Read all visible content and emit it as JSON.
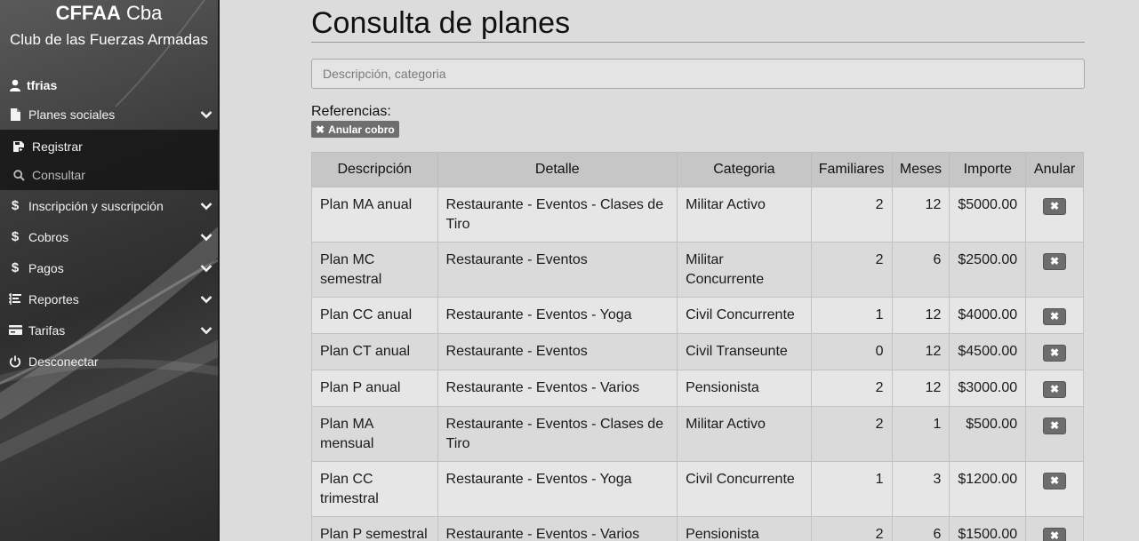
{
  "sidebar": {
    "brand_bold": "CFFAA",
    "brand_rest": " Cba",
    "brand_sub": "Club de las Fuerzas Armadas",
    "user": "tfrias",
    "items": [
      {
        "label": "Planes sociales",
        "icon": "file-icon"
      },
      {
        "label": "Inscripción y suscripción",
        "icon": "dollar-icon"
      },
      {
        "label": "Cobros",
        "icon": "dollar-icon"
      },
      {
        "label": "Pagos",
        "icon": "dollar-icon"
      },
      {
        "label": "Reportes",
        "icon": "list-icon"
      },
      {
        "label": "Tarifas",
        "icon": "card-icon"
      },
      {
        "label": "Desconectar",
        "icon": "power-icon"
      }
    ],
    "submenu": [
      {
        "label": "Registrar",
        "icon": "register-icon"
      },
      {
        "label": "Consultar",
        "icon": "search-icon"
      }
    ]
  },
  "main": {
    "title": "Consulta de planes",
    "search_placeholder": "Descripción, categoria",
    "refs_label": "Referencias:",
    "badge_label": "Anular cobro",
    "columns": [
      "Descripción",
      "Detalle",
      "Categoria",
      "Familiares",
      "Meses",
      "Importe",
      "Anular"
    ],
    "rows": [
      {
        "desc": "Plan MA anual",
        "detalle": "Restaurante - Eventos - Clases de Tiro",
        "categoria": "Militar Activo",
        "familiares": "2",
        "meses": "12",
        "importe": "$5000.00"
      },
      {
        "desc": "Plan MC semestral",
        "detalle": "Restaurante - Eventos",
        "categoria": "Militar Concurrente",
        "familiares": "2",
        "meses": "6",
        "importe": "$2500.00"
      },
      {
        "desc": "Plan CC anual",
        "detalle": "Restaurante - Eventos - Yoga",
        "categoria": "Civil Concurrente",
        "familiares": "1",
        "meses": "12",
        "importe": "$4000.00"
      },
      {
        "desc": "Plan CT anual",
        "detalle": "Restaurante - Eventos",
        "categoria": "Civil Transeunte",
        "familiares": "0",
        "meses": "12",
        "importe": "$4500.00"
      },
      {
        "desc": "Plan P anual",
        "detalle": "Restaurante - Eventos - Varios",
        "categoria": "Pensionista",
        "familiares": "2",
        "meses": "12",
        "importe": "$3000.00"
      },
      {
        "desc": "Plan MA mensual",
        "detalle": "Restaurante - Eventos - Clases de Tiro",
        "categoria": "Militar Activo",
        "familiares": "2",
        "meses": "1",
        "importe": "$500.00"
      },
      {
        "desc": "Plan CC trimestral",
        "detalle": "Restaurante - Eventos - Yoga",
        "categoria": "Civil Concurrente",
        "familiares": "1",
        "meses": "3",
        "importe": "$1200.00"
      },
      {
        "desc": "Plan P semestral",
        "detalle": "Restaurante - Eventos - Varios",
        "categoria": "Pensionista",
        "familiares": "2",
        "meses": "6",
        "importe": "$1500.00"
      }
    ]
  }
}
